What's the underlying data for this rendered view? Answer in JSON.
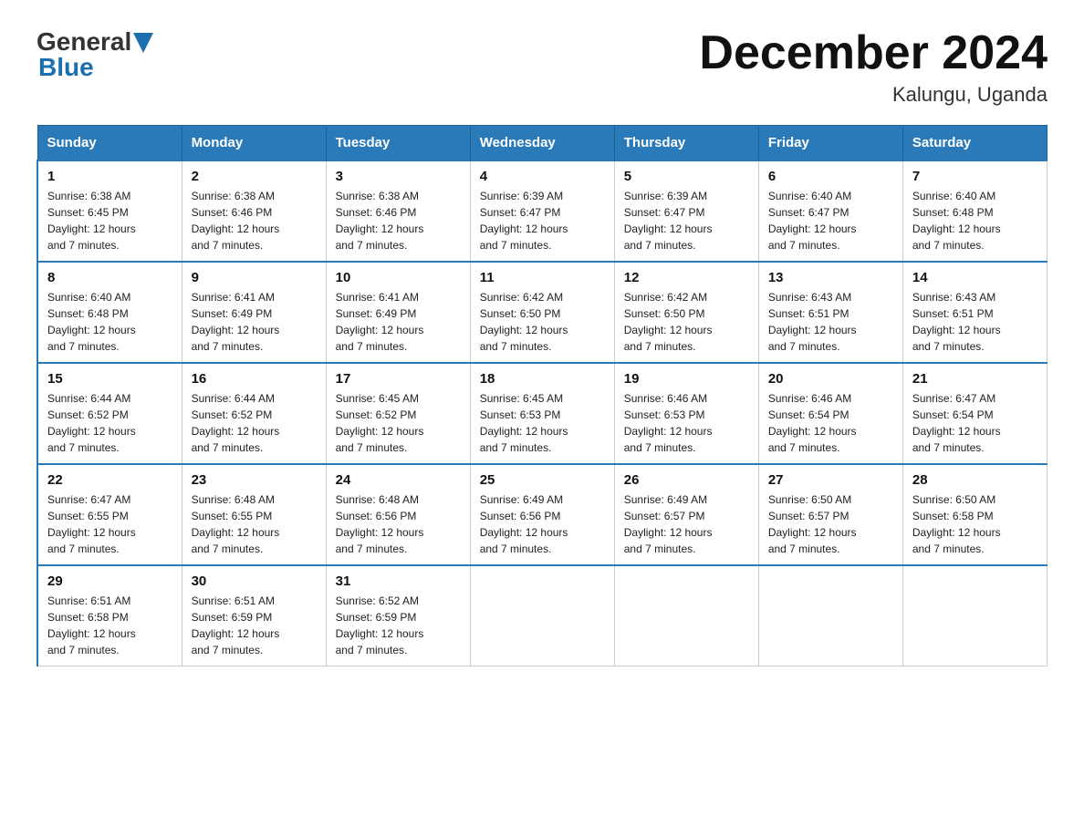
{
  "header": {
    "logo": {
      "general": "General",
      "blue": "Blue"
    },
    "title": "December 2024",
    "location": "Kalungu, Uganda"
  },
  "days_of_week": [
    "Sunday",
    "Monday",
    "Tuesday",
    "Wednesday",
    "Thursday",
    "Friday",
    "Saturday"
  ],
  "weeks": [
    [
      {
        "day": "1",
        "sunrise": "6:38 AM",
        "sunset": "6:45 PM",
        "daylight": "12 hours and 7 minutes."
      },
      {
        "day": "2",
        "sunrise": "6:38 AM",
        "sunset": "6:46 PM",
        "daylight": "12 hours and 7 minutes."
      },
      {
        "day": "3",
        "sunrise": "6:38 AM",
        "sunset": "6:46 PM",
        "daylight": "12 hours and 7 minutes."
      },
      {
        "day": "4",
        "sunrise": "6:39 AM",
        "sunset": "6:47 PM",
        "daylight": "12 hours and 7 minutes."
      },
      {
        "day": "5",
        "sunrise": "6:39 AM",
        "sunset": "6:47 PM",
        "daylight": "12 hours and 7 minutes."
      },
      {
        "day": "6",
        "sunrise": "6:40 AM",
        "sunset": "6:47 PM",
        "daylight": "12 hours and 7 minutes."
      },
      {
        "day": "7",
        "sunrise": "6:40 AM",
        "sunset": "6:48 PM",
        "daylight": "12 hours and 7 minutes."
      }
    ],
    [
      {
        "day": "8",
        "sunrise": "6:40 AM",
        "sunset": "6:48 PM",
        "daylight": "12 hours and 7 minutes."
      },
      {
        "day": "9",
        "sunrise": "6:41 AM",
        "sunset": "6:49 PM",
        "daylight": "12 hours and 7 minutes."
      },
      {
        "day": "10",
        "sunrise": "6:41 AM",
        "sunset": "6:49 PM",
        "daylight": "12 hours and 7 minutes."
      },
      {
        "day": "11",
        "sunrise": "6:42 AM",
        "sunset": "6:50 PM",
        "daylight": "12 hours and 7 minutes."
      },
      {
        "day": "12",
        "sunrise": "6:42 AM",
        "sunset": "6:50 PM",
        "daylight": "12 hours and 7 minutes."
      },
      {
        "day": "13",
        "sunrise": "6:43 AM",
        "sunset": "6:51 PM",
        "daylight": "12 hours and 7 minutes."
      },
      {
        "day": "14",
        "sunrise": "6:43 AM",
        "sunset": "6:51 PM",
        "daylight": "12 hours and 7 minutes."
      }
    ],
    [
      {
        "day": "15",
        "sunrise": "6:44 AM",
        "sunset": "6:52 PM",
        "daylight": "12 hours and 7 minutes."
      },
      {
        "day": "16",
        "sunrise": "6:44 AM",
        "sunset": "6:52 PM",
        "daylight": "12 hours and 7 minutes."
      },
      {
        "day": "17",
        "sunrise": "6:45 AM",
        "sunset": "6:52 PM",
        "daylight": "12 hours and 7 minutes."
      },
      {
        "day": "18",
        "sunrise": "6:45 AM",
        "sunset": "6:53 PM",
        "daylight": "12 hours and 7 minutes."
      },
      {
        "day": "19",
        "sunrise": "6:46 AM",
        "sunset": "6:53 PM",
        "daylight": "12 hours and 7 minutes."
      },
      {
        "day": "20",
        "sunrise": "6:46 AM",
        "sunset": "6:54 PM",
        "daylight": "12 hours and 7 minutes."
      },
      {
        "day": "21",
        "sunrise": "6:47 AM",
        "sunset": "6:54 PM",
        "daylight": "12 hours and 7 minutes."
      }
    ],
    [
      {
        "day": "22",
        "sunrise": "6:47 AM",
        "sunset": "6:55 PM",
        "daylight": "12 hours and 7 minutes."
      },
      {
        "day": "23",
        "sunrise": "6:48 AM",
        "sunset": "6:55 PM",
        "daylight": "12 hours and 7 minutes."
      },
      {
        "day": "24",
        "sunrise": "6:48 AM",
        "sunset": "6:56 PM",
        "daylight": "12 hours and 7 minutes."
      },
      {
        "day": "25",
        "sunrise": "6:49 AM",
        "sunset": "6:56 PM",
        "daylight": "12 hours and 7 minutes."
      },
      {
        "day": "26",
        "sunrise": "6:49 AM",
        "sunset": "6:57 PM",
        "daylight": "12 hours and 7 minutes."
      },
      {
        "day": "27",
        "sunrise": "6:50 AM",
        "sunset": "6:57 PM",
        "daylight": "12 hours and 7 minutes."
      },
      {
        "day": "28",
        "sunrise": "6:50 AM",
        "sunset": "6:58 PM",
        "daylight": "12 hours and 7 minutes."
      }
    ],
    [
      {
        "day": "29",
        "sunrise": "6:51 AM",
        "sunset": "6:58 PM",
        "daylight": "12 hours and 7 minutes."
      },
      {
        "day": "30",
        "sunrise": "6:51 AM",
        "sunset": "6:59 PM",
        "daylight": "12 hours and 7 minutes."
      },
      {
        "day": "31",
        "sunrise": "6:52 AM",
        "sunset": "6:59 PM",
        "daylight": "12 hours and 7 minutes."
      },
      null,
      null,
      null,
      null
    ]
  ],
  "labels": {
    "sunrise": "Sunrise:",
    "sunset": "Sunset:",
    "daylight": "Daylight:"
  }
}
